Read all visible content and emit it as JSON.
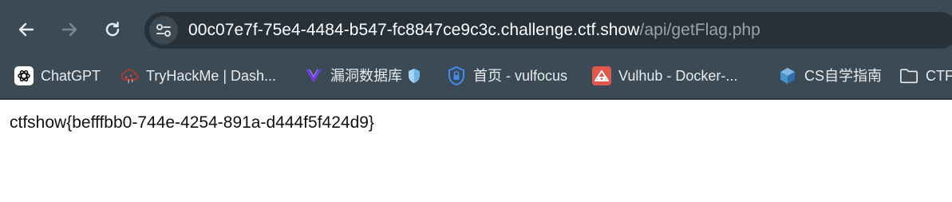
{
  "toolbar": {
    "back_icon": "arrow-left-icon",
    "forward_icon": "arrow-right-icon",
    "reload_icon": "reload-icon",
    "site_info_icon": "tune-icon"
  },
  "address_bar": {
    "host": "00c07e7f-75e4-4484-b547-fc8847ce9c3c.challenge.ctf.show",
    "path": "/api/getFlag.php"
  },
  "bookmarks": [
    {
      "label": "ChatGPT",
      "icon": "chatgpt-logo-icon"
    },
    {
      "label": "TryHackMe | Dash...",
      "icon": "cloud-hacker-icon"
    },
    {
      "label": "漏洞数据库",
      "icon": "v-logo-icon",
      "extra_icon": "shield-icon"
    },
    {
      "label": "首页 - vulfocus",
      "icon": "shield-lock-icon"
    },
    {
      "label": "Vulhub - Docker-...",
      "icon": "vulhub-logo-icon"
    },
    {
      "label": "CS自学指南",
      "icon": "cube-icon"
    },
    {
      "label": "CTF",
      "icon": "folder-icon"
    }
  ],
  "page": {
    "content": "ctfshow{befffbb0-744e-4254-891a-d444f5f424d9}"
  },
  "colors": {
    "chrome_bg": "#3b4a55",
    "omnibox_bg": "#26313a",
    "page_bg": "#ffffff"
  }
}
